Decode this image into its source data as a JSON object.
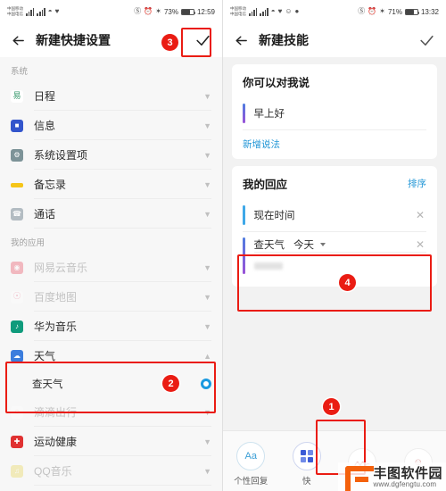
{
  "left_phone": {
    "status_bar": {
      "carrier_line1": "中国移动",
      "carrier_line2": "中国电信",
      "icons": [
        "signal-icon",
        "signal-icon",
        "wifi-icon",
        "vpn-icon"
      ],
      "dnd_icon": "do-not-disturb-icon",
      "alarm_icon": "alarm-icon",
      "bluetooth_icon": "bluetooth-icon",
      "battery_percent": "73%",
      "time": "12:59"
    },
    "appbar": {
      "back_icon": "back-arrow-icon",
      "title": "新建快捷设置",
      "confirm_icon": "checkmark-icon"
    },
    "sections": [
      {
        "title": "系统",
        "items": [
          {
            "label": "日程",
            "icon": "calendar-icon",
            "icon_color": "#3a9a6e",
            "icon_glyph": "易",
            "dimmed": false
          },
          {
            "label": "信息",
            "icon": "message-icon",
            "icon_color": "#3355cc",
            "icon_glyph": "▣",
            "dimmed": false
          },
          {
            "label": "系统设置项",
            "icon": "settings-icon",
            "icon_color": "#6a8a8a",
            "icon_glyph": "✿",
            "dimmed": false
          },
          {
            "label": "备忘录",
            "icon": "memo-icon",
            "icon_color": "#f5c518",
            "icon_glyph": "",
            "dimmed": false
          },
          {
            "label": "通话",
            "icon": "phone-icon",
            "icon_color": "#9aa5ad",
            "icon_glyph": "☏",
            "dimmed": false
          }
        ]
      },
      {
        "title": "我的应用",
        "items": [
          {
            "label": "网易云音乐",
            "icon": "netease-music-icon",
            "icon_color": "#e8455a",
            "icon_glyph": "◉",
            "dimmed": true
          },
          {
            "label": "百度地图",
            "icon": "baidu-map-icon",
            "icon_color": "#e86a8a",
            "icon_glyph": "⚲",
            "dimmed": true
          },
          {
            "label": "华为音乐",
            "icon": "huawei-music-icon",
            "icon_color": "#0f9b7c",
            "icon_glyph": "♪",
            "dimmed": false
          },
          {
            "label": "天气",
            "icon": "weather-icon",
            "icon_color": "#3b7ddd",
            "icon_glyph": "☁",
            "dimmed": false,
            "expanded": true,
            "children": [
              {
                "label": "查天气",
                "selected": true
              }
            ]
          },
          {
            "label": "滴滴出行",
            "icon": "didi-icon",
            "icon_color": "#f28a2e",
            "icon_glyph": "◔",
            "dimmed": true
          },
          {
            "label": "运动健康",
            "icon": "health-icon",
            "icon_color": "#e03131",
            "icon_glyph": "♥",
            "dimmed": false
          },
          {
            "label": "QQ音乐",
            "icon": "qq-music-icon",
            "icon_color": "#e8d44a",
            "icon_glyph": "♫",
            "dimmed": true
          }
        ]
      }
    ],
    "annotations": [
      {
        "label": "3",
        "target": "confirm-checkmark"
      },
      {
        "label": "2",
        "target": "weather-expanded-group"
      }
    ]
  },
  "right_phone": {
    "status_bar": {
      "carrier_line1": "中国移动",
      "carrier_line2": "中国电信",
      "battery_percent": "71%",
      "time": "13:32"
    },
    "appbar": {
      "back_icon": "back-arrow-icon",
      "title": "新建技能",
      "confirm_icon": "checkmark-icon"
    },
    "say_card": {
      "title": "你可以对我说",
      "entries": [
        {
          "text": "早上好"
        }
      ],
      "add_link": "新增说法"
    },
    "response_card": {
      "title": "我的回应",
      "sort_action": "排序",
      "entries": [
        {
          "text": "现在时间",
          "close_icon": "close-icon",
          "bar": "blue"
        }
      ],
      "skill_entry": {
        "name": "查天气",
        "value": "今天",
        "dropdown_icon": "chevron-down-icon",
        "close_icon": "close-icon",
        "field_value": ""
      }
    },
    "toolbar": {
      "items": [
        {
          "label": "个性回复",
          "icon": "text-aa-icon",
          "glyph": "Aa"
        },
        {
          "label": "快",
          "icon": "grid-apps-icon",
          "glyph": ""
        },
        {
          "label": "",
          "icon": "wave-icon",
          "glyph": ""
        },
        {
          "label": "",
          "icon": "person-icon",
          "glyph": ""
        }
      ]
    },
    "annotations": [
      {
        "label": "1",
        "target": "toolbar-grid-button"
      },
      {
        "label": "4",
        "target": "skill-entry-row"
      }
    ]
  },
  "watermark": {
    "name": "丰图软件园",
    "url": "www.dgfengtu.com",
    "logo_icon": "fengtu-logo-icon",
    "color": "#f4610c"
  },
  "colors": {
    "annotation_red": "#ea1c13",
    "link_blue": "#2196d6",
    "select_blue": "#1a9ae0"
  }
}
